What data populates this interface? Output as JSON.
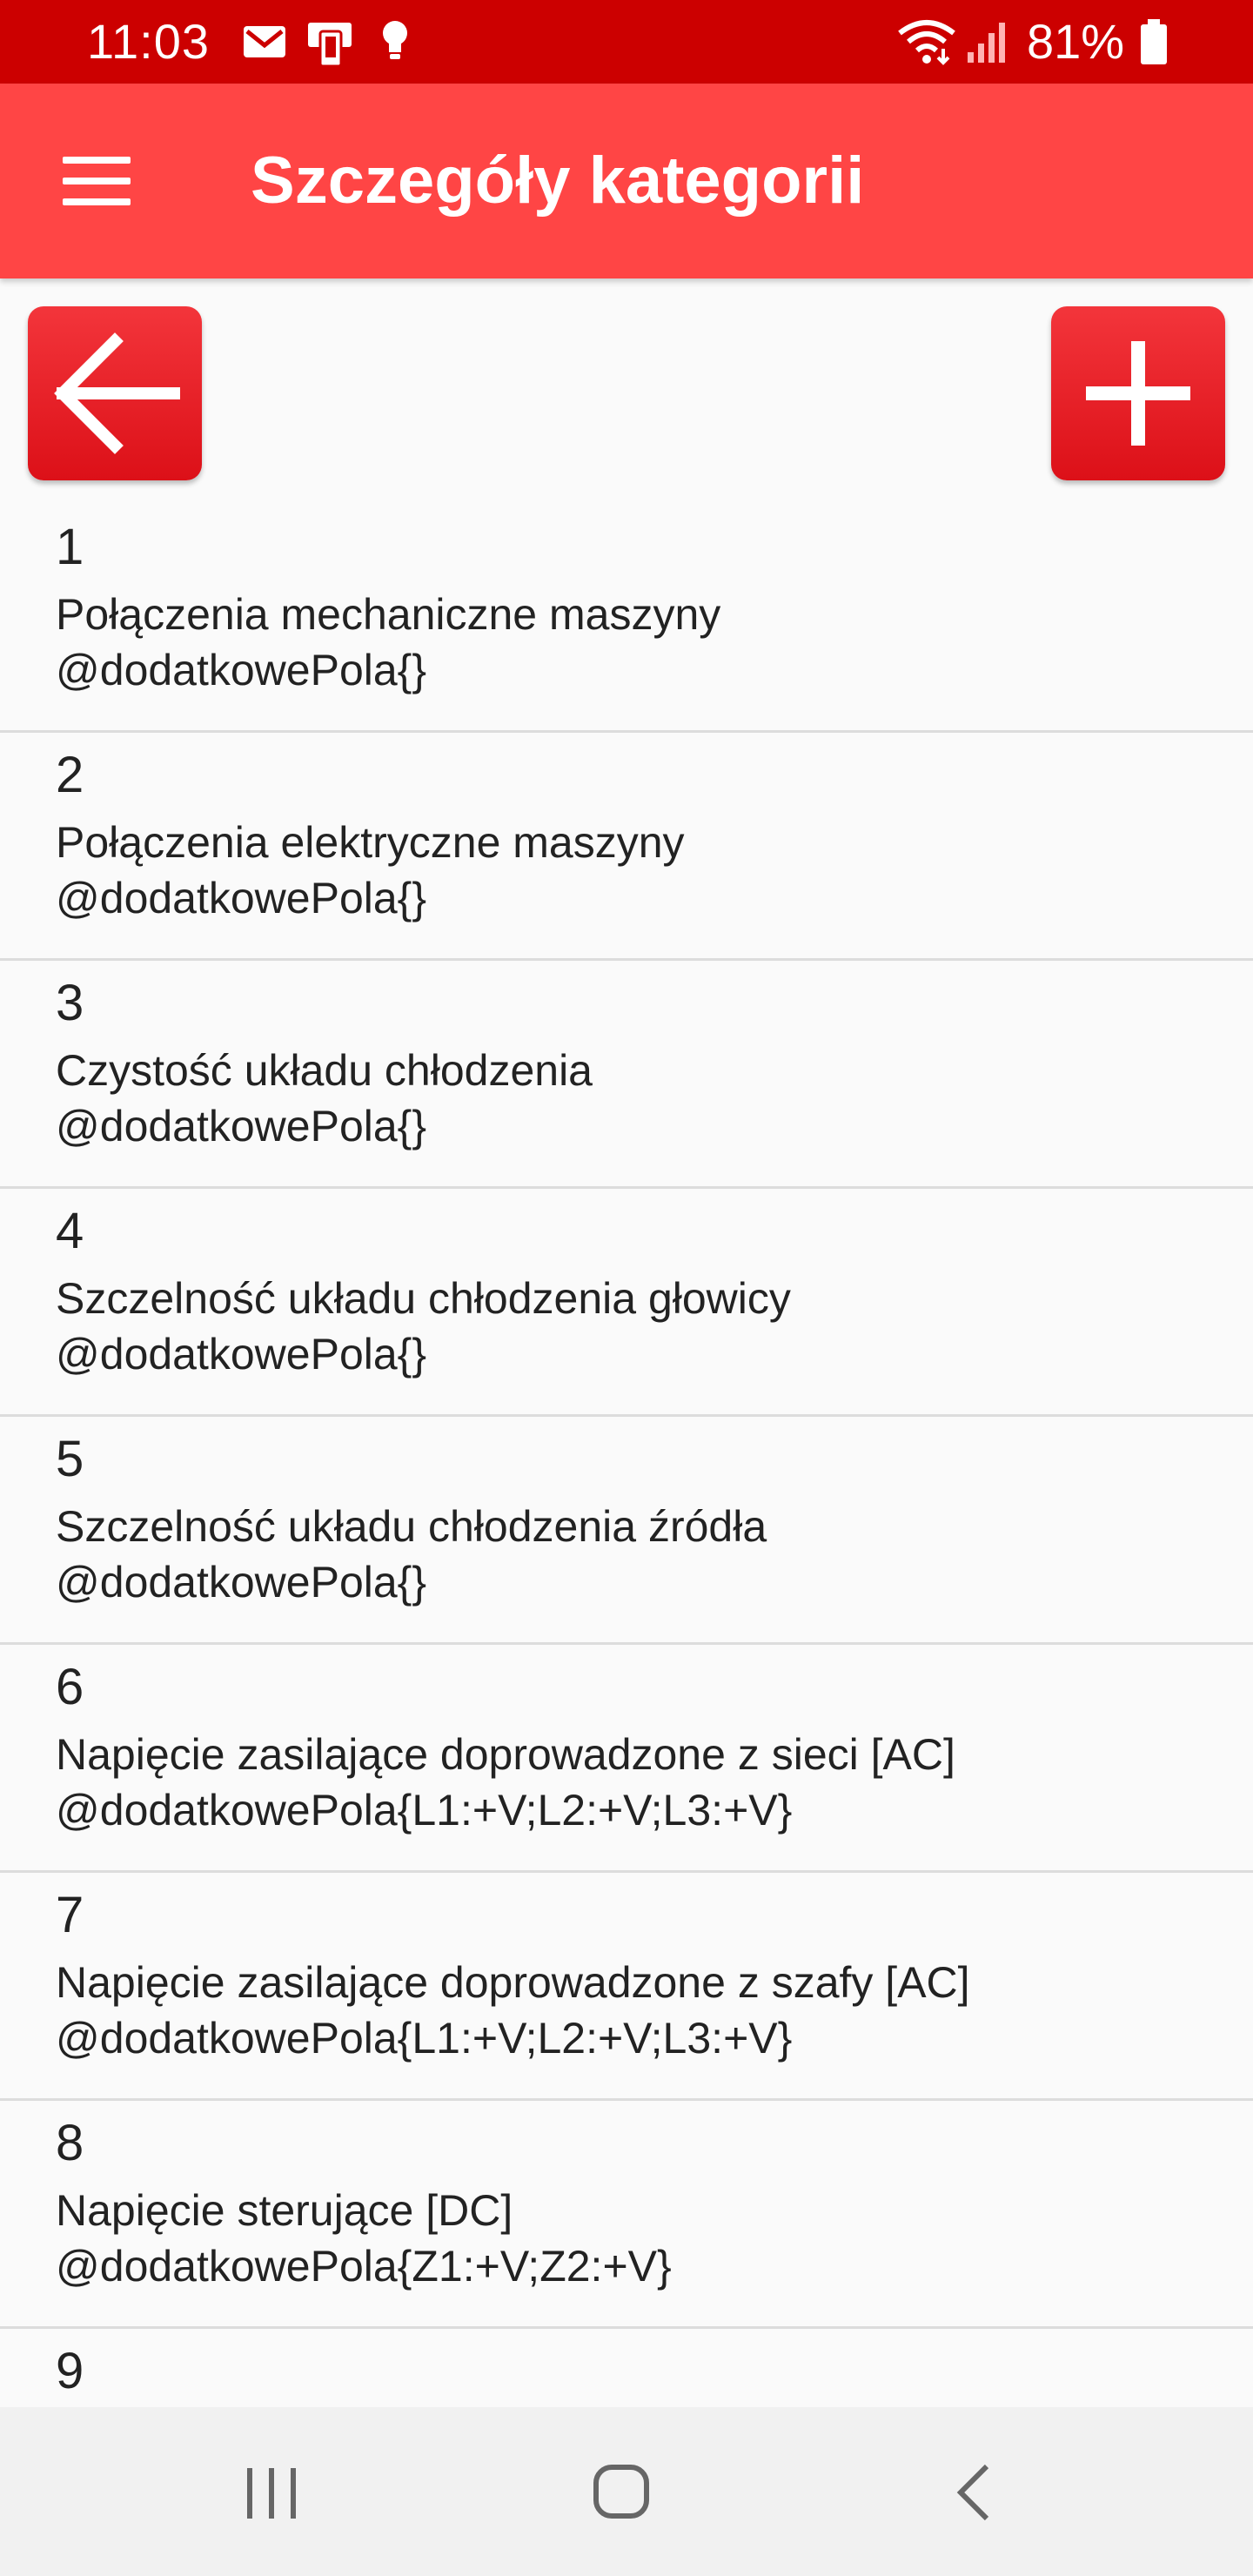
{
  "status_bar": {
    "time": "11:03",
    "battery": "81%",
    "icons": [
      "gmail-icon",
      "device-icon",
      "bulb-icon",
      "wifi-icon",
      "signal-icon",
      "battery-icon"
    ]
  },
  "app_bar": {
    "title": "Szczegóły kategorii",
    "menu_icon": "menu-icon"
  },
  "actions": {
    "back_icon": "arrow-left-icon",
    "add_icon": "plus-icon"
  },
  "list": {
    "items": [
      {
        "num": "1",
        "title": "Połączenia mechaniczne maszyny",
        "extra": "@dodatkowePola{}"
      },
      {
        "num": "2",
        "title": "Połączenia elektryczne maszyny",
        "extra": "@dodatkowePola{}"
      },
      {
        "num": "3",
        "title": "Czystość układu chłodzenia",
        "extra": "@dodatkowePola{}"
      },
      {
        "num": "4",
        "title": "Szczelność układu chłodzenia głowicy",
        "extra": "@dodatkowePola{}"
      },
      {
        "num": "5",
        "title": "Szczelność układu chłodzenia źródła",
        "extra": "@dodatkowePola{}"
      },
      {
        "num": "6",
        "title": "Napięcie zasilające doprowadzone z sieci [AC]",
        "extra": "@dodatkowePola{L1:+V;L2:+V;L3:+V}"
      },
      {
        "num": "7",
        "title": "Napięcie zasilające doprowadzone z szafy [AC]",
        "extra": "@dodatkowePola{L1:+V;L2:+V;L3:+V}"
      },
      {
        "num": "8",
        "title": "Napięcie sterujące [DC]",
        "extra": "@dodatkowePola{Z1:+V;Z2:+V}"
      },
      {
        "num": "9",
        "title": "",
        "extra": ""
      }
    ]
  },
  "colors": {
    "status_bar": "#cc0000",
    "app_bar": "#ff4545",
    "button": "#e8161e",
    "background": "#fafafa"
  },
  "nav_bar": {
    "icons": [
      "recent-apps-icon",
      "home-icon",
      "back-nav-icon"
    ]
  }
}
